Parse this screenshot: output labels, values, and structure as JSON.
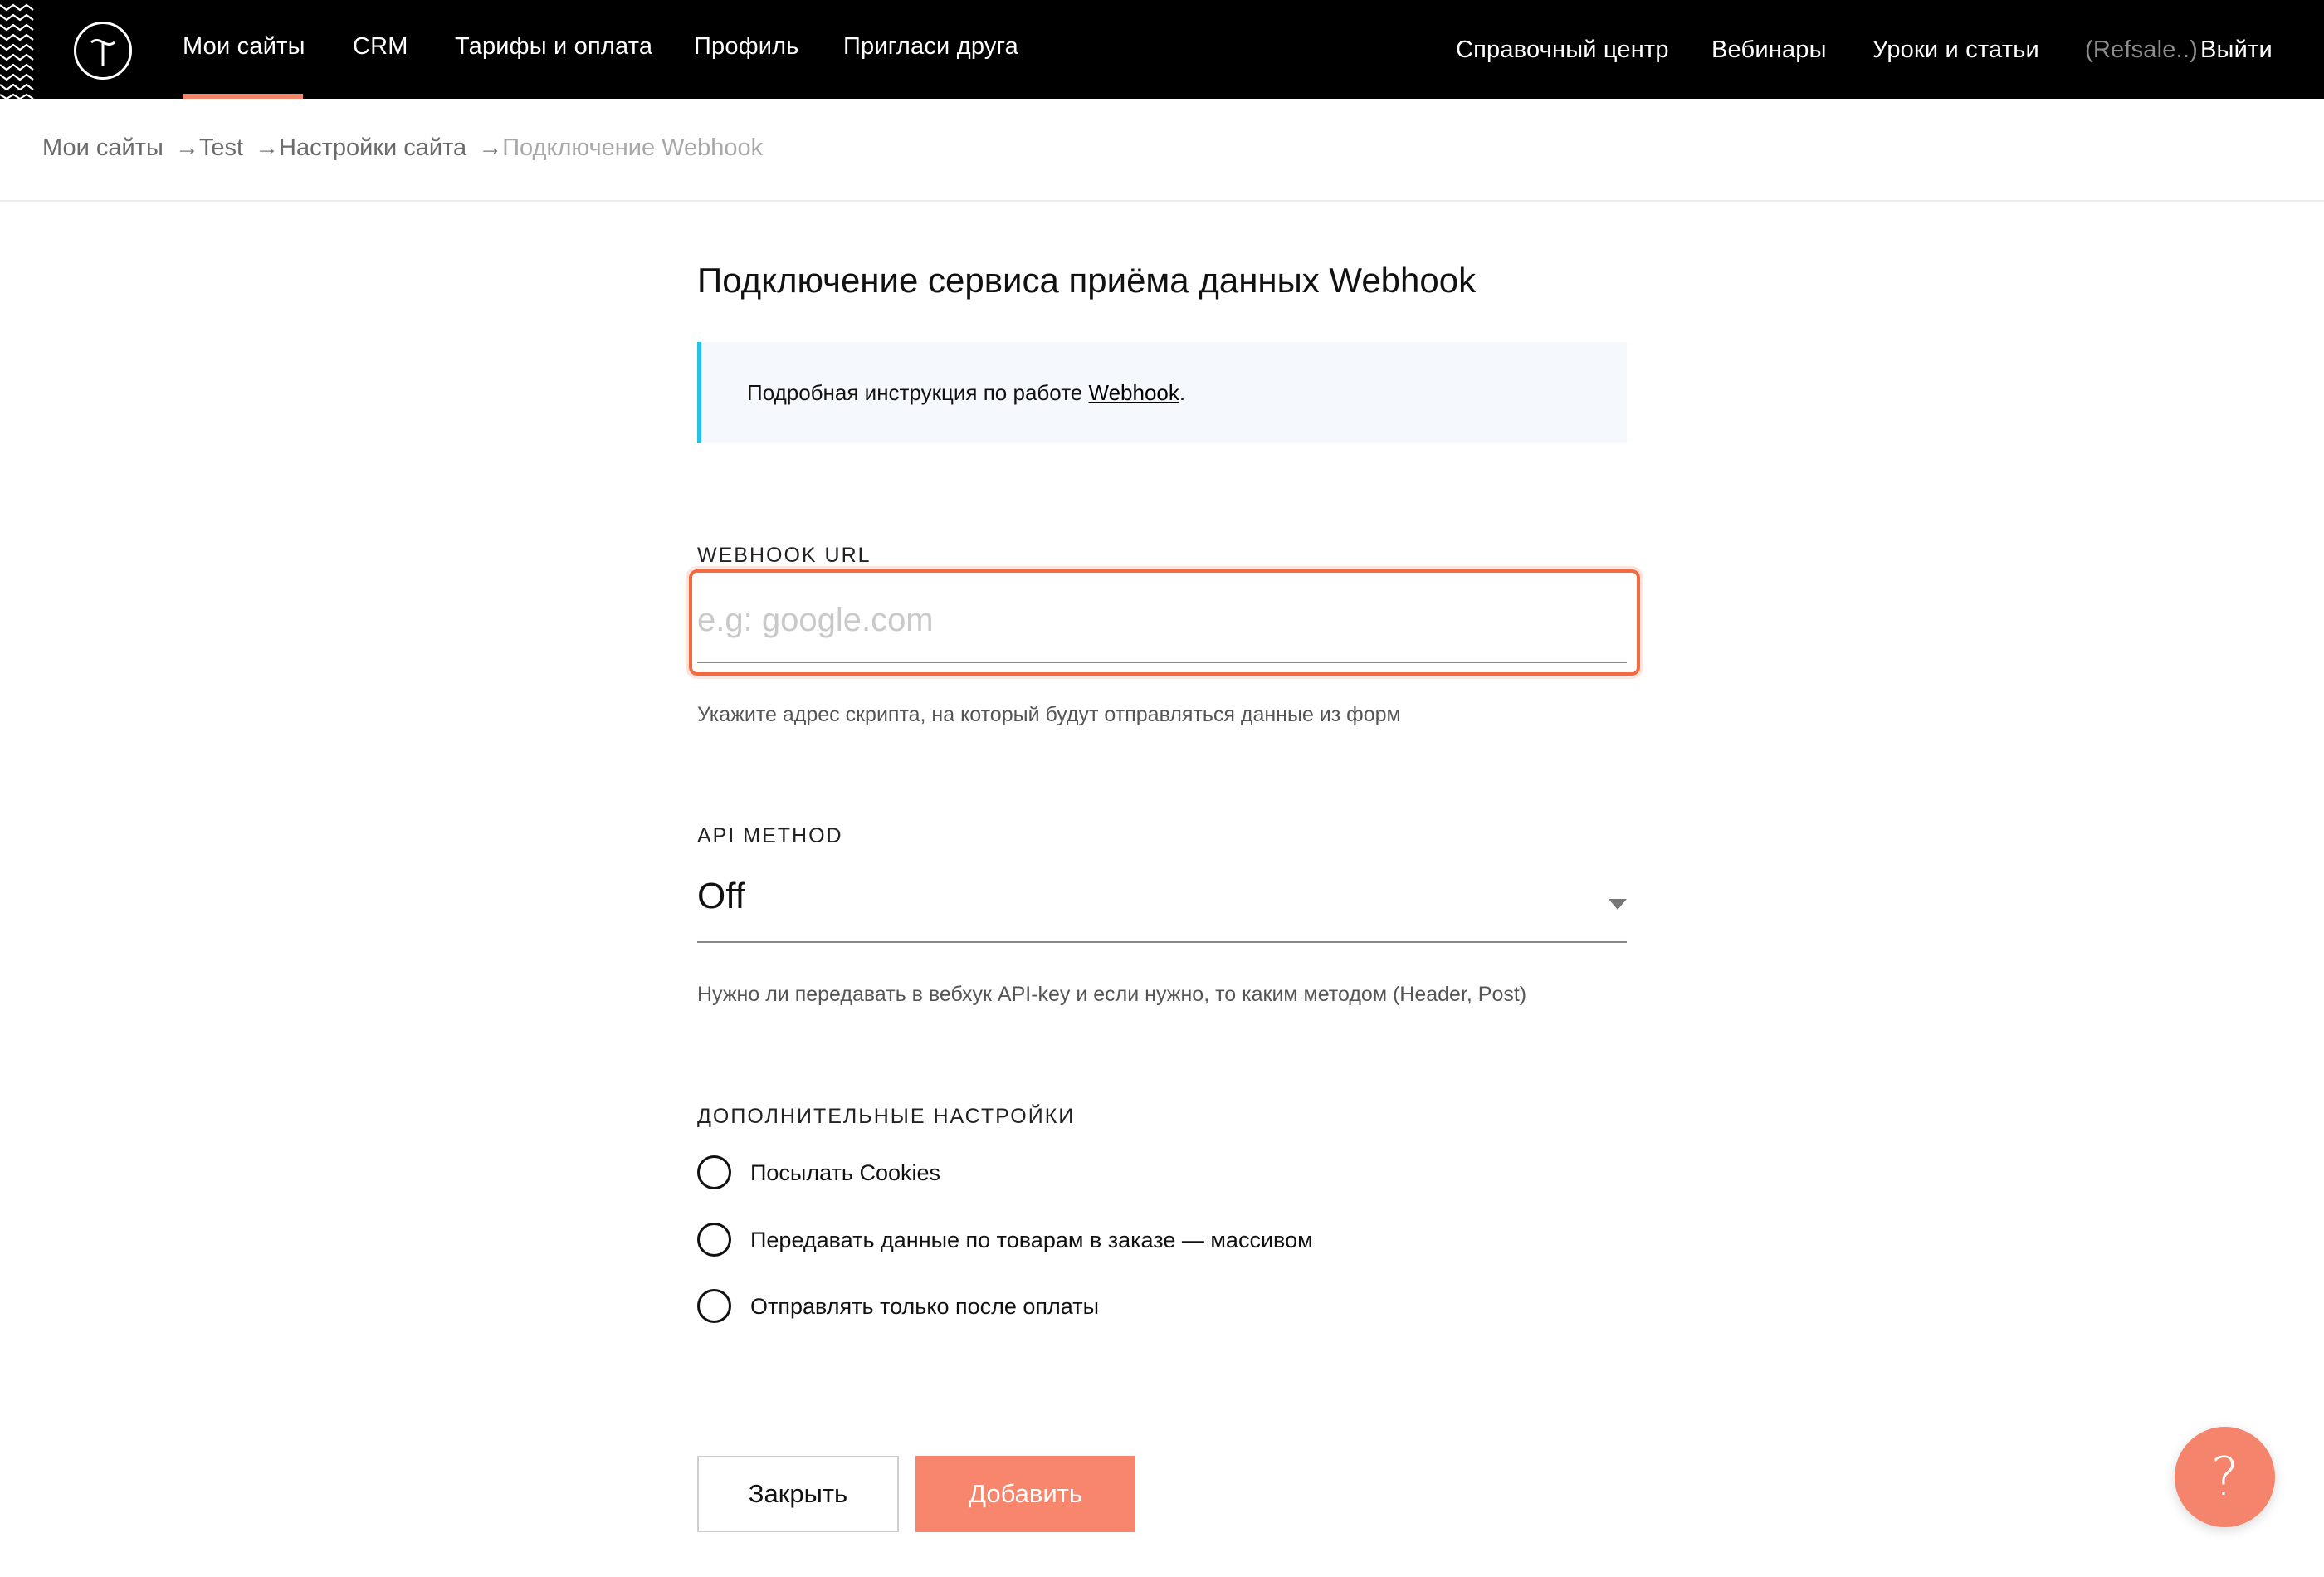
{
  "nav": {
    "left_items": [
      "Мои сайты",
      "CRM",
      "Тарифы и оплата",
      "Профиль",
      "Пригласи друга"
    ],
    "right_items": [
      "Справочный центр",
      "Вебинары",
      "Уроки и статьи"
    ],
    "user_label": "(Refsale..)",
    "logout_label": "Выйти",
    "active_color": "#f4846b"
  },
  "breadcrumb": {
    "items": [
      "Мои сайты",
      "Test",
      "Настройки сайта"
    ],
    "separator": "→",
    "current": "Подключение Webhook"
  },
  "page": {
    "title": "Подключение сервиса приёма данных Webhook",
    "info": {
      "text_before": "Подробная инструкция по работе ",
      "link": "Webhook",
      "text_after": ".",
      "accent_color": "#29c0e8"
    }
  },
  "webhook_url": {
    "label": "WEBHOOK URL",
    "value": "",
    "placeholder": "e.g: google.com",
    "hint": "Укажите адрес скрипта, на который будут отправляться данные из форм",
    "highlight_color": "#f26a3f"
  },
  "api_method": {
    "label": "API METHOD",
    "selected": "Off",
    "hint": "Нужно ли передавать в вебхук API-key и если нужно, то каким методом (Header, Post)"
  },
  "additional": {
    "label": "ДОПОЛНИТЕЛЬНЫЕ НАСТРОЙКИ",
    "options": [
      {
        "label": "Посылать Cookies",
        "checked": false
      },
      {
        "label": "Передавать данные по товарам в заказе — массивом",
        "checked": false
      },
      {
        "label": "Отправлять только после оплаты",
        "checked": false
      }
    ]
  },
  "buttons": {
    "close": "Закрыть",
    "add": "Добавить",
    "add_color": "#f8866c"
  },
  "help": {
    "symbol": "?",
    "color": "#f4846b"
  }
}
